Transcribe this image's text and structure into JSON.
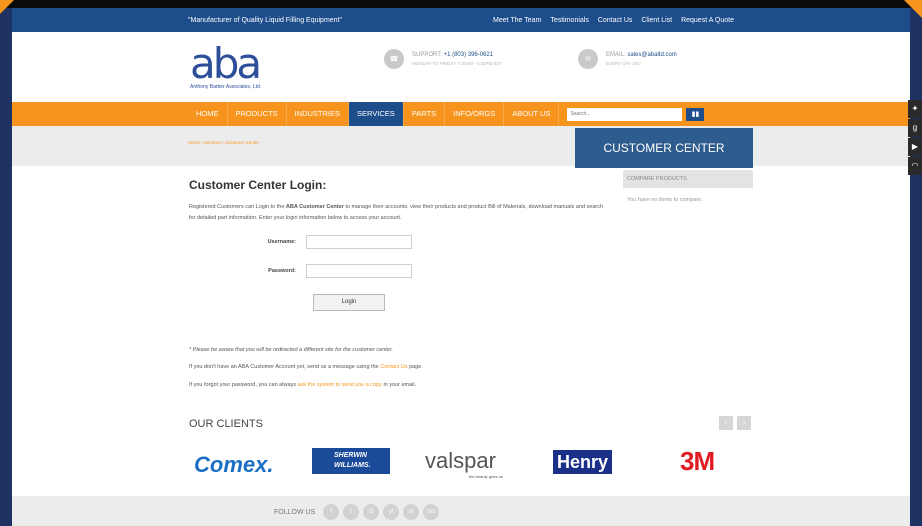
{
  "topbar": {
    "tagline": "\"Manufacturer of Quality Liquid Filling Equipment\"",
    "links": [
      "Meet The Team",
      "Testimonials",
      "Contact Us",
      "Client List",
      "Request A Quote"
    ]
  },
  "logo": {
    "mark": "aba",
    "subtitle": "Anthony Barber Associates, Ltd."
  },
  "support": {
    "label": "SUPPORT:",
    "phone": "+1 (803) 396-0621",
    "hours": "MONDAY TO FRIDAY 7:30AM - 4:30PM EST"
  },
  "email": {
    "label": "EMAIL:",
    "address": "sales@abaltd.com",
    "note": "EVERY DAY 24/7"
  },
  "nav": {
    "items": [
      "HOME",
      "PRODUCTS",
      "INDUSTRIES",
      "SERVICES",
      "PARTS",
      "INFO/ORGS",
      "ABOUT US"
    ],
    "active": "SERVICES",
    "search_placeholder": "Search..."
  },
  "breadcrumb": "Home / Services / Customer Center",
  "sidebar": {
    "title": "CUSTOMER CENTER",
    "compare_label": "COMPARE PRODUCTS",
    "compare_empty": "You have no items to compare."
  },
  "main": {
    "heading": "Customer Center Login:",
    "intro_pre": "Registered Customers can Login to the ",
    "intro_bold": "ABA Customer Center",
    "intro_post": " to manage their accounts, view their products and product Bill of Materials, download manuals and search for detailed part information.  Enter your login information below to access your account.",
    "username_label": "Username:",
    "username_value": "",
    "password_label": "Password:",
    "password_value": "",
    "login_button": "Login",
    "redirect_note": "* Please be aware that you will be redirected a different site for the customer center.",
    "no_account_pre": "If you don't have an ABA Customer Account yet, send us a message using the ",
    "no_account_link": "Contact Us",
    "no_account_post": " page.",
    "forgot_pre": "If you forgot your password, you can always ",
    "forgot_link": "ask the system to send you a copy",
    "forgot_post": " in your email."
  },
  "clients": {
    "title": "OUR CLIENTS",
    "logos": [
      "Comex.",
      "SHERWIN WILLIAMS.",
      "valspar",
      "Henry",
      "3M"
    ],
    "valspar_tagline": "the beauty goes on"
  },
  "footer": {
    "follow_label": "FOLLOW US",
    "social": [
      "f",
      "t",
      "G",
      "yt",
      "in",
      "rss"
    ]
  },
  "side_social": [
    "twitter-icon",
    "google-plus-icon",
    "youtube-icon",
    "rss-icon"
  ],
  "colors": {
    "brand_blue": "#1d4d8a",
    "brand_orange": "#f7941d",
    "panel_blue": "#2e5c8e"
  }
}
